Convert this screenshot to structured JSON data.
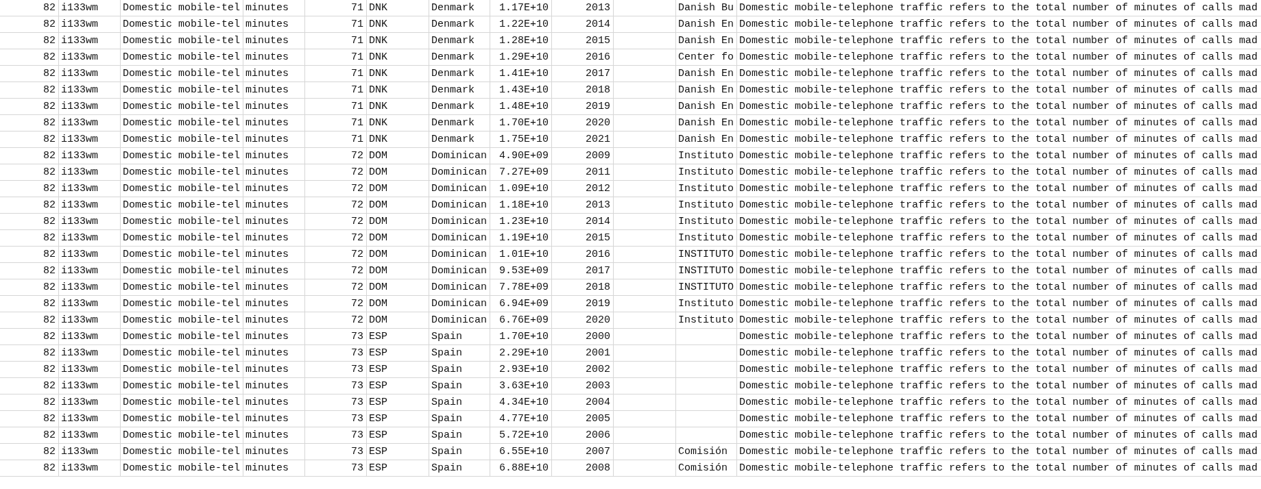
{
  "table": {
    "rows": [
      {
        "column_1": "82",
        "column_2": "i133wm",
        "column_3": "Domestic mobile-tel",
        "column_4": "minutes",
        "column_5": "71",
        "column_6": "DNK",
        "column_7": "Denmark",
        "column_8": "1.17E+10",
        "column_9": "2013",
        "column_11": "Danish Bu",
        "column_12": "Domestic mobile-telephone traffic refers to the total number of minutes of calls mad"
      },
      {
        "column_1": "82",
        "column_2": "i133wm",
        "column_3": "Domestic mobile-tel",
        "column_4": "minutes",
        "column_5": "71",
        "column_6": "DNK",
        "column_7": "Denmark",
        "column_8": "1.22E+10",
        "column_9": "2014",
        "column_11": "Danish En",
        "column_12": "Domestic mobile-telephone traffic refers to the total number of minutes of calls mad"
      },
      {
        "column_1": "82",
        "column_2": "i133wm",
        "column_3": "Domestic mobile-tel",
        "column_4": "minutes",
        "column_5": "71",
        "column_6": "DNK",
        "column_7": "Denmark",
        "column_8": "1.28E+10",
        "column_9": "2015",
        "column_11": "Danish En",
        "column_12": "Domestic mobile-telephone traffic refers to the total number of minutes of calls mad"
      },
      {
        "column_1": "82",
        "column_2": "i133wm",
        "column_3": "Domestic mobile-tel",
        "column_4": "minutes",
        "column_5": "71",
        "column_6": "DNK",
        "column_7": "Denmark",
        "column_8": "1.29E+10",
        "column_9": "2016",
        "column_11": "Center fo",
        "column_12": "Domestic mobile-telephone traffic refers to the total number of minutes of calls mad"
      },
      {
        "column_1": "82",
        "column_2": "i133wm",
        "column_3": "Domestic mobile-tel",
        "column_4": "minutes",
        "column_5": "71",
        "column_6": "DNK",
        "column_7": "Denmark",
        "column_8": "1.41E+10",
        "column_9": "2017",
        "column_11": "Danish En",
        "column_12": "Domestic mobile-telephone traffic refers to the total number of minutes of calls mad"
      },
      {
        "column_1": "82",
        "column_2": "i133wm",
        "column_3": "Domestic mobile-tel",
        "column_4": "minutes",
        "column_5": "71",
        "column_6": "DNK",
        "column_7": "Denmark",
        "column_8": "1.43E+10",
        "column_9": "2018",
        "column_11": "Danish En",
        "column_12": "Domestic mobile-telephone traffic refers to the total number of minutes of calls mad"
      },
      {
        "column_1": "82",
        "column_2": "i133wm",
        "column_3": "Domestic mobile-tel",
        "column_4": "minutes",
        "column_5": "71",
        "column_6": "DNK",
        "column_7": "Denmark",
        "column_8": "1.48E+10",
        "column_9": "2019",
        "column_11": "Danish En",
        "column_12": "Domestic mobile-telephone traffic refers to the total number of minutes of calls mad"
      },
      {
        "column_1": "82",
        "column_2": "i133wm",
        "column_3": "Domestic mobile-tel",
        "column_4": "minutes",
        "column_5": "71",
        "column_6": "DNK",
        "column_7": "Denmark",
        "column_8": "1.70E+10",
        "column_9": "2020",
        "column_11": "Danish En",
        "column_12": "Domestic mobile-telephone traffic refers to the total number of minutes of calls mad"
      },
      {
        "column_1": "82",
        "column_2": "i133wm",
        "column_3": "Domestic mobile-tel",
        "column_4": "minutes",
        "column_5": "71",
        "column_6": "DNK",
        "column_7": "Denmark",
        "column_8": "1.75E+10",
        "column_9": "2021",
        "column_11": "Danish En",
        "column_12": "Domestic mobile-telephone traffic refers to the total number of minutes of calls mad"
      },
      {
        "column_1": "82",
        "column_2": "i133wm",
        "column_3": "Domestic mobile-tel",
        "column_4": "minutes",
        "column_5": "72",
        "column_6": "DOM",
        "column_7": "Dominican",
        "column_8": "4.90E+09",
        "column_9": "2009",
        "column_11": "Instituto",
        "column_12": "Domestic mobile-telephone traffic refers to the total number of minutes of calls mad"
      },
      {
        "column_1": "82",
        "column_2": "i133wm",
        "column_3": "Domestic mobile-tel",
        "column_4": "minutes",
        "column_5": "72",
        "column_6": "DOM",
        "column_7": "Dominican",
        "column_8": "7.27E+09",
        "column_9": "2011",
        "column_11": "Instituto",
        "column_12": "Domestic mobile-telephone traffic refers to the total number of minutes of calls mad"
      },
      {
        "column_1": "82",
        "column_2": "i133wm",
        "column_3": "Domestic mobile-tel",
        "column_4": "minutes",
        "column_5": "72",
        "column_6": "DOM",
        "column_7": "Dominican",
        "column_8": "1.09E+10",
        "column_9": "2012",
        "column_11": "Instituto",
        "column_12": "Domestic mobile-telephone traffic refers to the total number of minutes of calls mad"
      },
      {
        "column_1": "82",
        "column_2": "i133wm",
        "column_3": "Domestic mobile-tel",
        "column_4": "minutes",
        "column_5": "72",
        "column_6": "DOM",
        "column_7": "Dominican",
        "column_8": "1.18E+10",
        "column_9": "2013",
        "column_11": "Instituto",
        "column_12": "Domestic mobile-telephone traffic refers to the total number of minutes of calls mad"
      },
      {
        "column_1": "82",
        "column_2": "i133wm",
        "column_3": "Domestic mobile-tel",
        "column_4": "minutes",
        "column_5": "72",
        "column_6": "DOM",
        "column_7": "Dominican",
        "column_8": "1.23E+10",
        "column_9": "2014",
        "column_11": "Instituto",
        "column_12": "Domestic mobile-telephone traffic refers to the total number of minutes of calls mad"
      },
      {
        "column_1": "82",
        "column_2": "i133wm",
        "column_3": "Domestic mobile-tel",
        "column_4": "minutes",
        "column_5": "72",
        "column_6": "DOM",
        "column_7": "Dominican",
        "column_8": "1.19E+10",
        "column_9": "2015",
        "column_11": "Instituto",
        "column_12": "Domestic mobile-telephone traffic refers to the total number of minutes of calls mad"
      },
      {
        "column_1": "82",
        "column_2": "i133wm",
        "column_3": "Domestic mobile-tel",
        "column_4": "minutes",
        "column_5": "72",
        "column_6": "DOM",
        "column_7": "Dominican",
        "column_8": "1.01E+10",
        "column_9": "2016",
        "column_11": "INSTITUTO",
        "column_12": "Domestic mobile-telephone traffic refers to the total number of minutes of calls mad"
      },
      {
        "column_1": "82",
        "column_2": "i133wm",
        "column_3": "Domestic mobile-tel",
        "column_4": "minutes",
        "column_5": "72",
        "column_6": "DOM",
        "column_7": "Dominican",
        "column_8": "9.53E+09",
        "column_9": "2017",
        "column_11": "INSTITUTO",
        "column_12": "Domestic mobile-telephone traffic refers to the total number of minutes of calls mad"
      },
      {
        "column_1": "82",
        "column_2": "i133wm",
        "column_3": "Domestic mobile-tel",
        "column_4": "minutes",
        "column_5": "72",
        "column_6": "DOM",
        "column_7": "Dominican",
        "column_8": "7.78E+09",
        "column_9": "2018",
        "column_11": "INSTITUTO",
        "column_12": "Domestic mobile-telephone traffic refers to the total number of minutes of calls mad"
      },
      {
        "column_1": "82",
        "column_2": "i133wm",
        "column_3": "Domestic mobile-tel",
        "column_4": "minutes",
        "column_5": "72",
        "column_6": "DOM",
        "column_7": "Dominican",
        "column_8": "6.94E+09",
        "column_9": "2019",
        "column_11": "Instituto",
        "column_12": "Domestic mobile-telephone traffic refers to the total number of minutes of calls mad"
      },
      {
        "column_1": "82",
        "column_2": "i133wm",
        "column_3": "Domestic mobile-tel",
        "column_4": "minutes",
        "column_5": "72",
        "column_6": "DOM",
        "column_7": "Dominican",
        "column_8": "6.76E+09",
        "column_9": "2020",
        "column_11": "Instituto",
        "column_12": "Domestic mobile-telephone traffic refers to the total number of minutes of calls mad"
      },
      {
        "column_1": "82",
        "column_2": "i133wm",
        "column_3": "Domestic mobile-tel",
        "column_4": "minutes",
        "column_5": "73",
        "column_6": "ESP",
        "column_7": "Spain",
        "column_8": "1.70E+10",
        "column_9": "2000",
        "column_12": "Domestic mobile-telephone traffic refers to the total number of minutes of calls mad"
      },
      {
        "column_1": "82",
        "column_2": "i133wm",
        "column_3": "Domestic mobile-tel",
        "column_4": "minutes",
        "column_5": "73",
        "column_6": "ESP",
        "column_7": "Spain",
        "column_8": "2.29E+10",
        "column_9": "2001",
        "column_12": "Domestic mobile-telephone traffic refers to the total number of minutes of calls mad"
      },
      {
        "column_1": "82",
        "column_2": "i133wm",
        "column_3": "Domestic mobile-tel",
        "column_4": "minutes",
        "column_5": "73",
        "column_6": "ESP",
        "column_7": "Spain",
        "column_8": "2.93E+10",
        "column_9": "2002",
        "column_12": "Domestic mobile-telephone traffic refers to the total number of minutes of calls mad"
      },
      {
        "column_1": "82",
        "column_2": "i133wm",
        "column_3": "Domestic mobile-tel",
        "column_4": "minutes",
        "column_5": "73",
        "column_6": "ESP",
        "column_7": "Spain",
        "column_8": "3.63E+10",
        "column_9": "2003",
        "column_12": "Domestic mobile-telephone traffic refers to the total number of minutes of calls mad"
      },
      {
        "column_1": "82",
        "column_2": "i133wm",
        "column_3": "Domestic mobile-tel",
        "column_4": "minutes",
        "column_5": "73",
        "column_6": "ESP",
        "column_7": "Spain",
        "column_8": "4.34E+10",
        "column_9": "2004",
        "column_12": "Domestic mobile-telephone traffic refers to the total number of minutes of calls mad"
      },
      {
        "column_1": "82",
        "column_2": "i133wm",
        "column_3": "Domestic mobile-tel",
        "column_4": "minutes",
        "column_5": "73",
        "column_6": "ESP",
        "column_7": "Spain",
        "column_8": "4.77E+10",
        "column_9": "2005",
        "column_12": "Domestic mobile-telephone traffic refers to the total number of minutes of calls mad"
      },
      {
        "column_1": "82",
        "column_2": "i133wm",
        "column_3": "Domestic mobile-tel",
        "column_4": "minutes",
        "column_5": "73",
        "column_6": "ESP",
        "column_7": "Spain",
        "column_8": "5.72E+10",
        "column_9": "2006",
        "column_12": "Domestic mobile-telephone traffic refers to the total number of minutes of calls mad"
      },
      {
        "column_1": "82",
        "column_2": "i133wm",
        "column_3": "Domestic mobile-tel",
        "column_4": "minutes",
        "column_5": "73",
        "column_6": "ESP",
        "column_7": "Spain",
        "column_8": "6.55E+10",
        "column_9": "2007",
        "column_11": "Comisión",
        "column_12": "Domestic mobile-telephone traffic refers to the total number of minutes of calls mad"
      },
      {
        "column_1": "82",
        "column_2": "i133wm",
        "column_3": "Domestic mobile-tel",
        "column_4": "minutes",
        "column_5": "73",
        "column_6": "ESP",
        "column_7": "Spain",
        "column_8": "6.88E+10",
        "column_9": "2008",
        "column_11": "Comisión",
        "column_12": "Domestic mobile-telephone traffic refers to the total number of minutes of calls mad"
      }
    ]
  }
}
